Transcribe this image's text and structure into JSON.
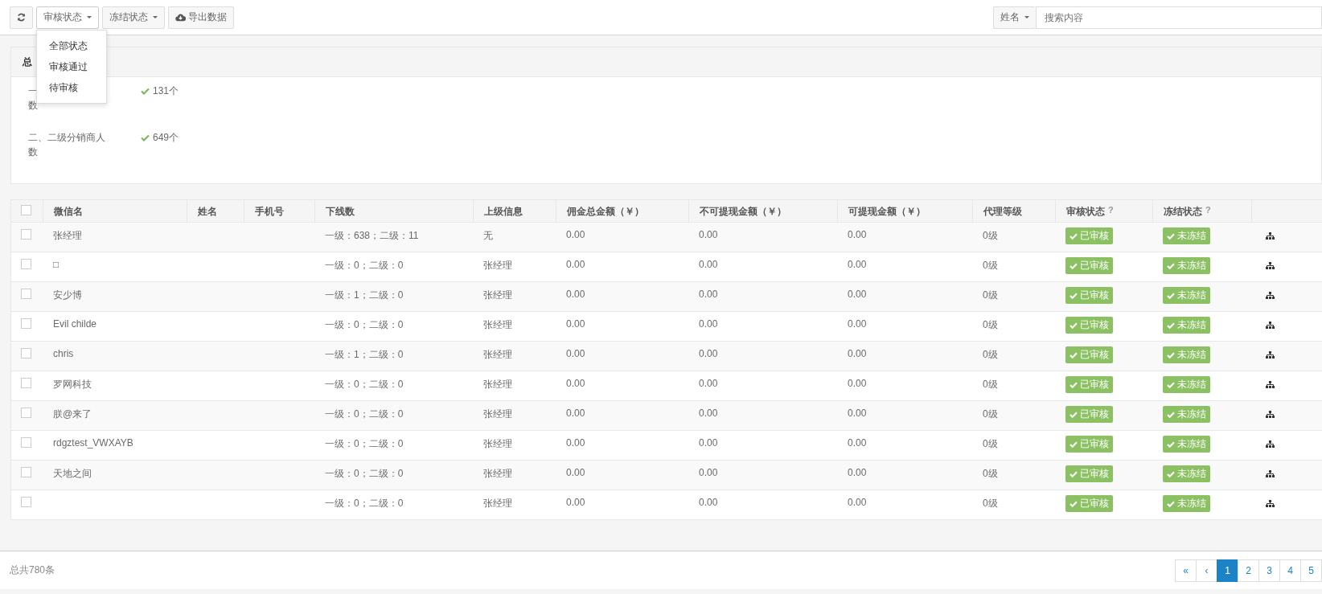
{
  "toolbar": {
    "buttons": [
      {
        "kind": "refresh"
      },
      {
        "kind": "dropdown",
        "label": "审核状态",
        "expanded": true
      },
      {
        "kind": "dropdown",
        "label": "冻结状态",
        "expanded": false
      },
      {
        "kind": "export",
        "label": "导出数据"
      }
    ]
  },
  "dropdown_menu": {
    "items": [
      "全部状态",
      "审核通过",
      "待审核"
    ]
  },
  "search": {
    "field_label": "姓名",
    "placeholder": "搜索内容"
  },
  "summary_panel": {
    "title": "总",
    "stats": [
      {
        "label_line_1": "一",
        "label_line_2": "数",
        "value": "131个"
      },
      {
        "label_line_1": "二、二级分销商人",
        "label_line_2": "数",
        "value": "649个"
      }
    ]
  },
  "table": {
    "columns": [
      "微信名",
      "姓名",
      "手机号",
      "下线数",
      "上级信息",
      "佣金总金额（￥）",
      "不可提现金额（￥）",
      "可提现金额（￥）",
      "代理等级",
      "审核状态",
      "冻结状态"
    ],
    "help_mark": "?",
    "select_all_checked": false,
    "rows": [
      {
        "checked": false,
        "wechat": "张经理",
        "downline": "一级：638；二级：11",
        "parent": "无",
        "commission": "0.00",
        "locked": "0.00",
        "available": "0.00",
        "level": "0级",
        "audit": "已审核",
        "freeze": "未冻结"
      },
      {
        "checked": false,
        "wechat": "□",
        "downline": "一级：0；二级：0",
        "parent": "张经理",
        "commission": "0.00",
        "locked": "0.00",
        "available": "0.00",
        "level": "0级",
        "audit": "已审核",
        "freeze": "未冻结"
      },
      {
        "checked": false,
        "wechat": "安少博",
        "downline": "一级：1；二级：0",
        "parent": "张经理",
        "commission": "0.00",
        "locked": "0.00",
        "available": "0.00",
        "level": "0级",
        "audit": "已审核",
        "freeze": "未冻结"
      },
      {
        "checked": false,
        "wechat": "Evil childe",
        "downline": "一级：0；二级：0",
        "parent": "张经理",
        "commission": "0.00",
        "locked": "0.00",
        "available": "0.00",
        "level": "0级",
        "audit": "已审核",
        "freeze": "未冻结"
      },
      {
        "checked": false,
        "wechat": "chris",
        "downline": "一级：1；二级：0",
        "parent": "张经理",
        "commission": "0.00",
        "locked": "0.00",
        "available": "0.00",
        "level": "0级",
        "audit": "已审核",
        "freeze": "未冻结"
      },
      {
        "checked": false,
        "wechat": "罗网科技",
        "downline": "一级：0；二级：0",
        "parent": "张经理",
        "commission": "0.00",
        "locked": "0.00",
        "available": "0.00",
        "level": "0级",
        "audit": "已审核",
        "freeze": "未冻结"
      },
      {
        "checked": false,
        "wechat": "朕@来了",
        "downline": "一级：0；二级：0",
        "parent": "张经理",
        "commission": "0.00",
        "locked": "0.00",
        "available": "0.00",
        "level": "0级",
        "audit": "已审核",
        "freeze": "未冻结"
      },
      {
        "checked": false,
        "wechat": "rdgztest_VWXAYB",
        "downline": "一级：0；二级：0",
        "parent": "张经理",
        "commission": "0.00",
        "locked": "0.00",
        "available": "0.00",
        "level": "0级",
        "audit": "已审核",
        "freeze": "未冻结"
      },
      {
        "checked": false,
        "wechat": "天地之间",
        "downline": "一级：0；二级：0",
        "parent": "张经理",
        "commission": "0.00",
        "locked": "0.00",
        "available": "0.00",
        "level": "0级",
        "audit": "已审核",
        "freeze": "未冻结"
      },
      {
        "checked": false,
        "downline": "一级：0；二级：0",
        "parent": "张经理",
        "commission": "0.00",
        "locked": "0.00",
        "available": "0.00",
        "level": "0级",
        "audit": "已审核",
        "freeze": "未冻结"
      }
    ]
  },
  "footer": {
    "total": "总共780条"
  },
  "pagination": [
    {
      "label": "«",
      "selected": false
    },
    {
      "label": "‹",
      "selected": false
    },
    {
      "label": "1",
      "selected": true
    },
    {
      "label": "2",
      "selected": false
    },
    {
      "label": "3",
      "selected": false
    },
    {
      "label": "4",
      "selected": false
    },
    {
      "label": "5",
      "selected": false
    }
  ]
}
